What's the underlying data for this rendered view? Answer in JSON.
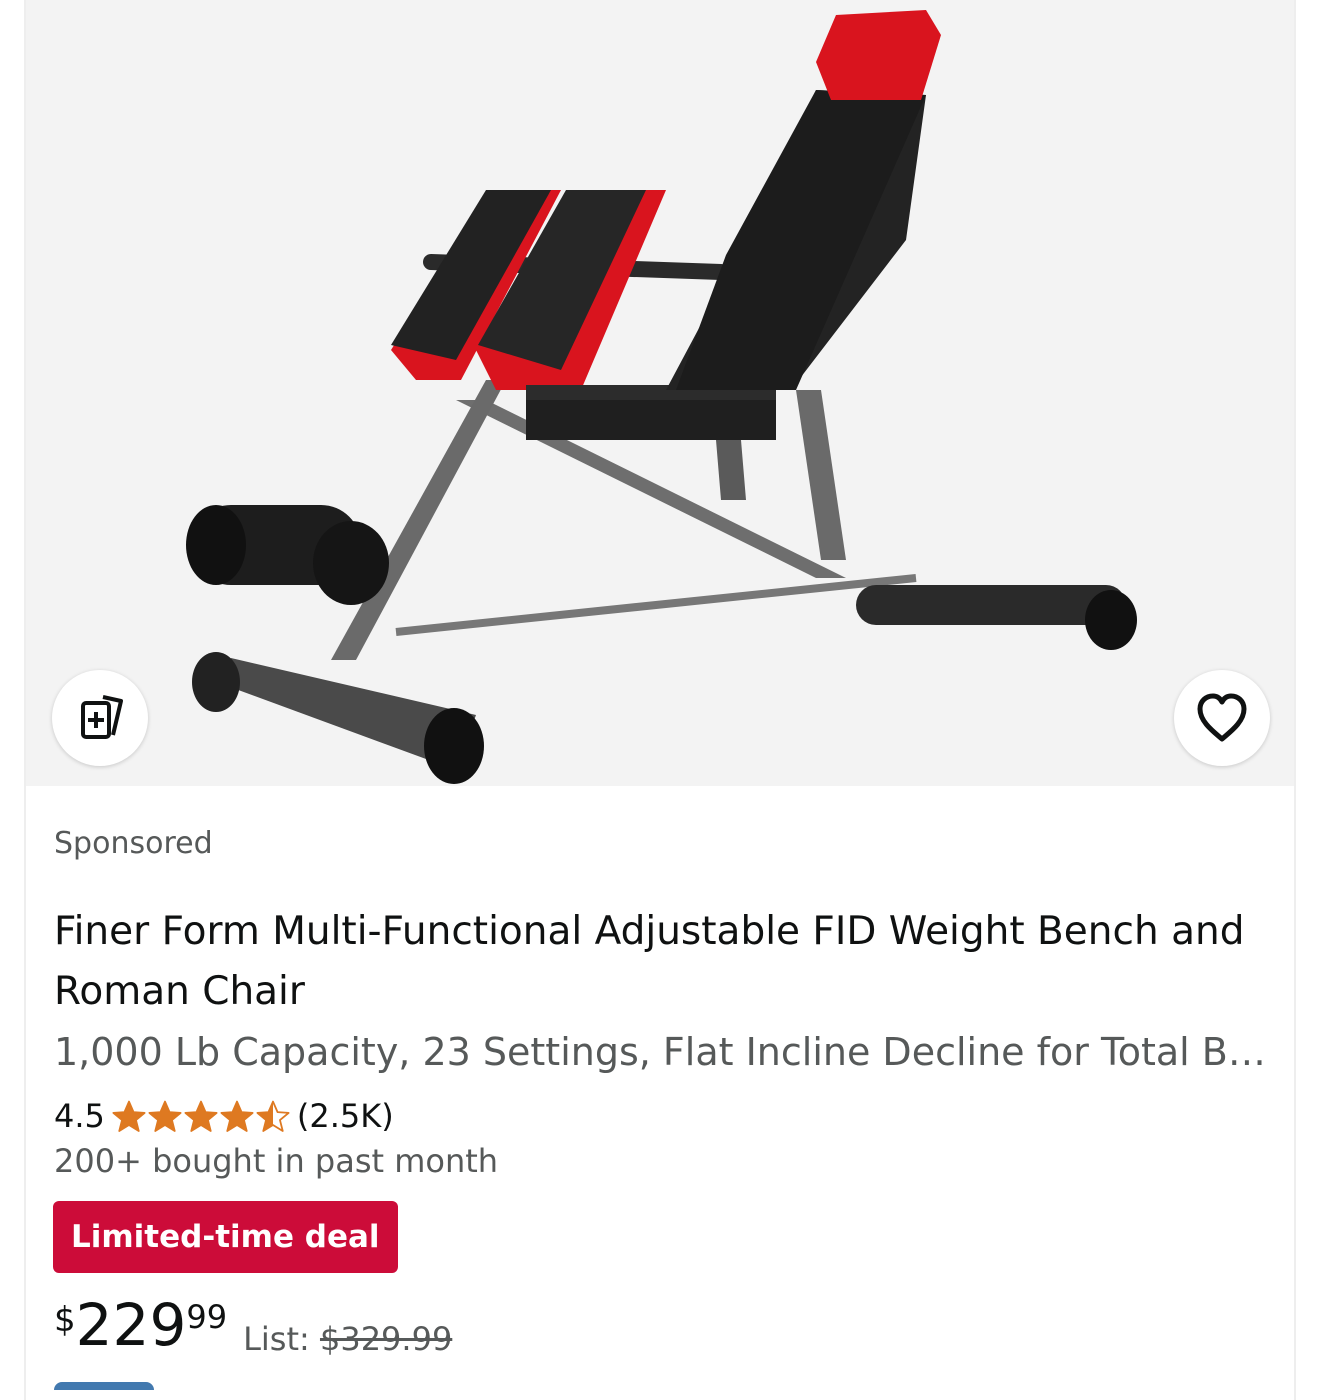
{
  "product": {
    "sponsored_label": "Sponsored",
    "title": "Finer Form Multi-Functional Adjustable FID Weight Bench and Roman Chair",
    "subtitle": "1,000 Lb Capacity, 23 Settings, Flat Incline Decline for Total B…",
    "rating_value": "4.5",
    "rating_stars": 4.5,
    "rating_count": "(2.5K)",
    "bought_text": "200+ bought in past month",
    "deal_label": "Limited-time deal",
    "price_symbol": "$",
    "price_whole": "229",
    "price_fraction": "99",
    "list_label": "List:",
    "list_price": "$329.99"
  },
  "icons": {
    "compare": "compare-add-icon",
    "wishlist": "heart-icon",
    "star": "star-icon"
  },
  "colors": {
    "deal_red": "#cc0c39",
    "star_orange": "#de7921",
    "muted_text": "#565959",
    "bench_red": "#d9141e"
  }
}
